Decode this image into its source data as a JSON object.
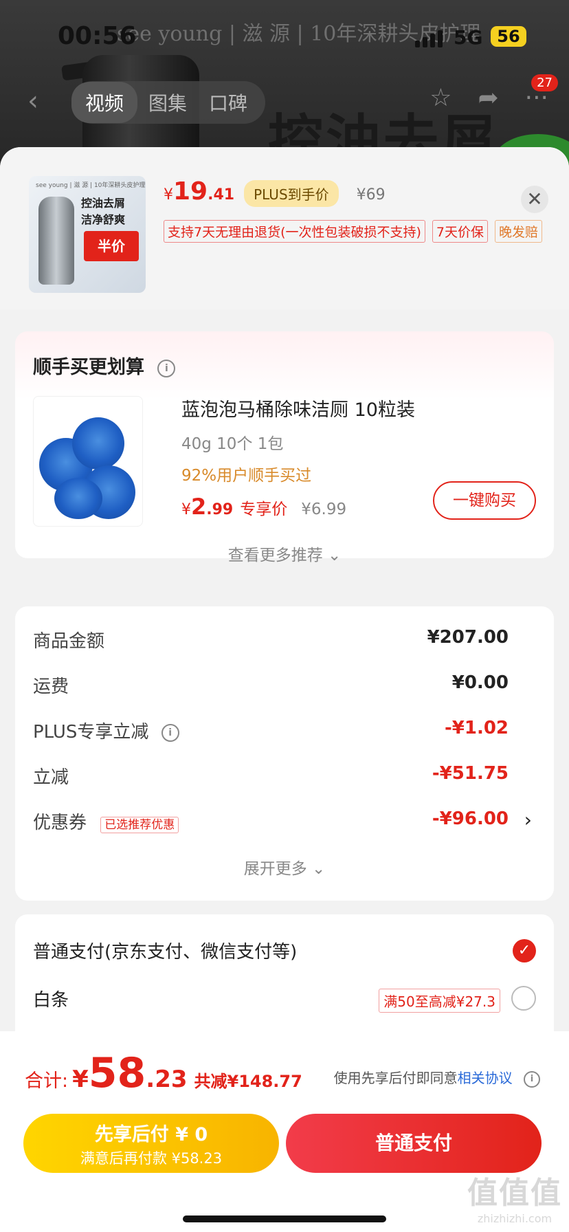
{
  "status": {
    "time": "00:56",
    "network": "5G",
    "battery": "56"
  },
  "background": {
    "brand": "see young | 滋 源 | 10年深耕头皮护理",
    "headline": "控油去屑"
  },
  "nav": {
    "tabs": [
      "视频",
      "图集",
      "口碑"
    ],
    "badge": "27"
  },
  "product": {
    "thumb_small": "see young | 滋 源 | 10年深耕头皮护理",
    "thumb_line1": "控油去屑",
    "thumb_line2": "洁净舒爽",
    "thumb_tag": "半价",
    "price_symbol": "¥",
    "price_int": "19",
    "price_dec": ".41",
    "plus_label": "PLUS到手价",
    "original_price": "¥69",
    "tags": [
      "支持7天无理由退货(一次性包装破损不支持)",
      "7天价保",
      "晚发赔"
    ]
  },
  "addon": {
    "title": "顺手买更划算",
    "name": "蓝泡泡马桶除味洁厕 10粒装",
    "spec": "40g 10个 1包",
    "sold": "92%用户顺手买过",
    "price_symbol": "¥",
    "price_int": "2",
    "price_dec": ".99",
    "price_label": "专享价",
    "original": "¥6.99",
    "buy_label": "一键购买",
    "more_label": "查看更多推荐 ⌄"
  },
  "summary": {
    "rows": [
      {
        "label": "商品金额",
        "value": "¥207.00"
      },
      {
        "label": "运费",
        "value": "¥0.00"
      },
      {
        "label": "PLUS专享立减",
        "value": "-¥1.02"
      },
      {
        "label": "立减",
        "value": "-¥51.75"
      },
      {
        "label": "优惠券",
        "value": "-¥96.00",
        "tag": "已选推荐优惠"
      }
    ],
    "more_label": "展开更多 ⌄"
  },
  "payment": {
    "options": [
      {
        "label": "普通支付(京东支付、微信支付等)"
      },
      {
        "label": "白条",
        "promo": "满50至高减¥27.3"
      }
    ]
  },
  "footer": {
    "total_label": "合计:",
    "total_symbol": "¥",
    "total_int": "58",
    "total_dec": ".23",
    "discount": "共减¥148.77",
    "agree_text": "使用先享后付即同意",
    "agree_link": "相关协议",
    "btn_left_line1": "先享后付 ¥ 0",
    "btn_left_line2": "满意后再付款 ¥58.23",
    "btn_right": "普通支付"
  },
  "watermark": {
    "logo": "值值值",
    "url": "zhizhizhi.com"
  },
  "colors": {
    "accent": "#e2231a",
    "plus": "#fbe6a6",
    "yellow": "#ffd500"
  }
}
